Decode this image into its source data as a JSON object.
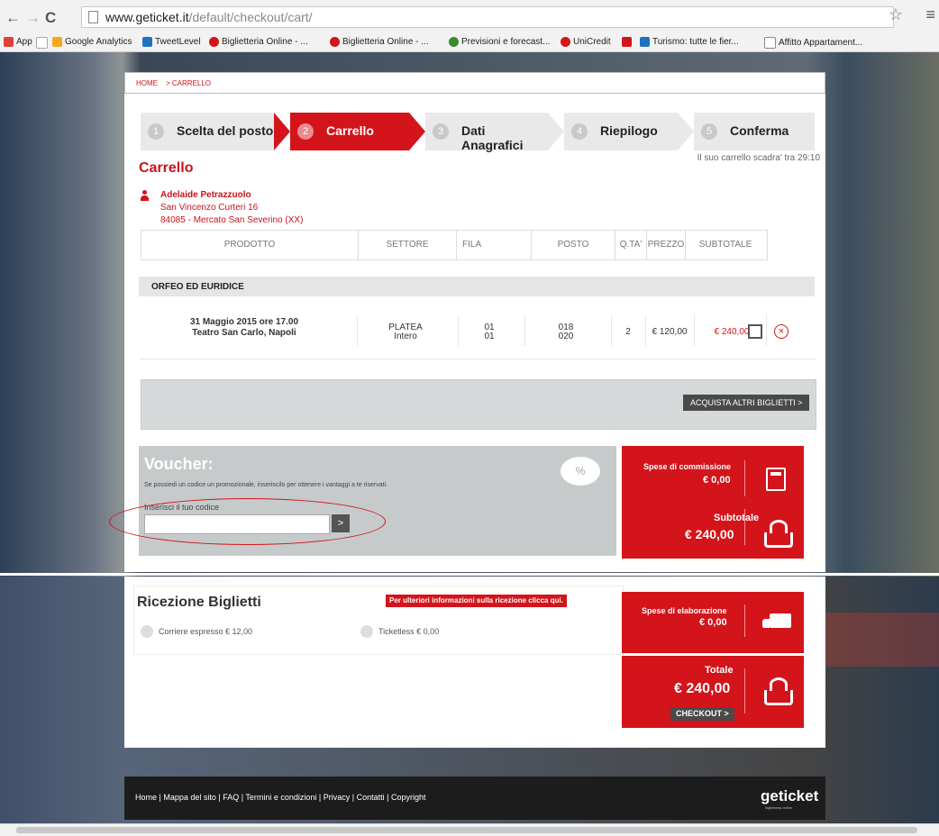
{
  "browser": {
    "url_host": "www.geticket.it",
    "url_path": "/default/checkout/cart/",
    "bookmarks": [
      {
        "label": "App",
        "color": "#e2413a"
      },
      {
        "label": "",
        "color": "#cccccc"
      },
      {
        "label": "Google Analytics",
        "color": "#f5a623"
      },
      {
        "label": "TweetLevel",
        "color": "#1e73be"
      },
      {
        "label": "Biglietteria Online - ...",
        "color": "#d3141b"
      },
      {
        "label": "Biglietteria Online - ...",
        "color": "#d3141b"
      },
      {
        "label": "Previsioni e forecast...",
        "color": "#3a8a2c"
      },
      {
        "label": "UniCredit",
        "color": "#d3141b"
      },
      {
        "label": "",
        "color": "#d3141b"
      },
      {
        "label": "Turismo: tutte le fier...",
        "color": "#1e73be"
      },
      {
        "label": "Affitto Appartament...",
        "color": "#888888"
      }
    ]
  },
  "breadcrumb": {
    "home": "HOME",
    "current": "> CARRELLO"
  },
  "steps": [
    {
      "num": "1",
      "label": "Scelta del posto"
    },
    {
      "num": "2",
      "label": "Carrello"
    },
    {
      "num": "3",
      "label": "Dati Anagrafici"
    },
    {
      "num": "4",
      "label": "Riepilogo"
    },
    {
      "num": "5",
      "label": "Conferma"
    }
  ],
  "expire": "Il suo carrello scadra' tra 29:10",
  "title": "Carrello",
  "user": {
    "name": "Adelaide Petrazzuolo",
    "address": "San Vincenzo Curteri 16",
    "city": "84085 - Mercato San Severino (XX)"
  },
  "table": {
    "headers": [
      "PRODOTTO",
      "SETTORE",
      "FILA",
      "POSTO",
      "Q.TA'",
      "PREZZO",
      "SUBTOTALE"
    ],
    "product": "ORFEO ED EURIDICE",
    "row": {
      "date": "31 Maggio 2015 ore 17.00",
      "venue": "Teatro San Carlo, Napoli",
      "sector": "PLATEA",
      "sector2": "Intero",
      "fila1": "01",
      "fila2": "01",
      "posto1": "018",
      "posto2": "020",
      "qty": "2",
      "price": "€ 120,00",
      "subtotal": "€ 240,00"
    }
  },
  "acquista": "ACQUISTA ALTRI BIGLIETTI >",
  "voucher": {
    "title": "Voucher:",
    "desc": "Se possiedi un codice un promozionale, inseriscilo per ottenere i vantaggi a te riservati.",
    "label": "Inserisci il tuo codice",
    "button": ">"
  },
  "summary": {
    "commission_label": "Spese di commissione",
    "commission_value": "€ 0,00",
    "subtotal_label": "Subtotale",
    "subtotal_value": "€ 240,00",
    "elab_label": "Spese di elaborazione",
    "elab_value": "€ 0,00",
    "total_label": "Totale",
    "total_value": "€ 240,00",
    "checkout": "CHECKOUT >"
  },
  "ricezione": {
    "title": "Ricezione Biglietti",
    "info": "Per ulteriori informazioni sulla ricezione clicca qui.",
    "opt1": "Corriere espresso € 12,00",
    "opt2": "Ticketless € 0,00"
  },
  "footer": {
    "links": "Home | Mappa del sito | FAQ | Termini e condizioni | Privacy | Contatti | Copyright",
    "logo": "geticket",
    "tagline": "biglietteria online"
  }
}
